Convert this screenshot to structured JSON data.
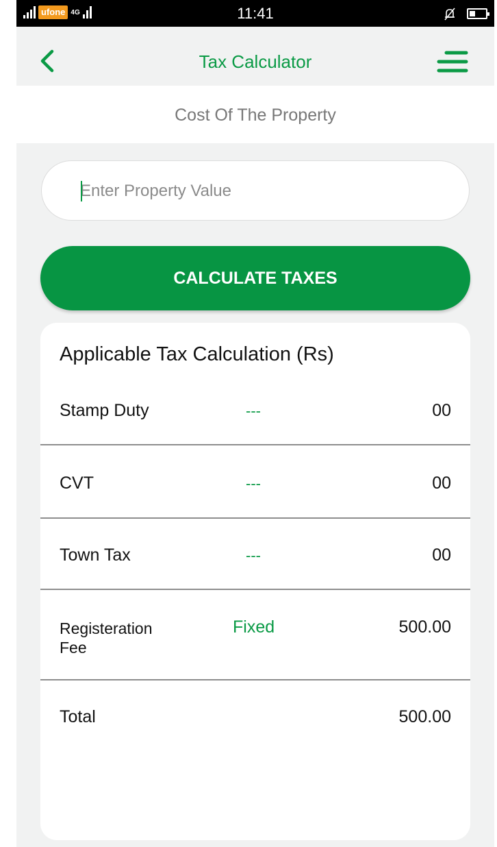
{
  "status_bar": {
    "carrier": "ufone",
    "network": "4G",
    "time": "11:41",
    "icons": [
      "signal-icon",
      "silent-icon",
      "battery-icon"
    ]
  },
  "app_bar": {
    "title": "Tax Calculator",
    "icons": [
      "back-chevron-icon",
      "menu-icon"
    ]
  },
  "section": {
    "title": "Cost Of The Property"
  },
  "input": {
    "placeholder": "Enter Property Value",
    "value": ""
  },
  "button": {
    "label": "CALCULATE TAXES"
  },
  "card": {
    "title": "Applicable Tax Calculation (Rs)",
    "rows": [
      {
        "label": "Stamp Duty",
        "rate": "---",
        "value": "00"
      },
      {
        "label": "CVT",
        "rate": "---",
        "value": "00"
      },
      {
        "label": "Town Tax",
        "rate": "---",
        "value": "00"
      },
      {
        "label_line1": "Registeration",
        "label_line2": "Fee",
        "rate": "Fixed",
        "value": "500.00"
      }
    ],
    "total": {
      "label": "Total",
      "value": "500.00"
    }
  },
  "colors": {
    "accent": "#079543",
    "background": "#f1f2f2",
    "status_bar": "#000000",
    "divider": "#8d8d8d"
  }
}
